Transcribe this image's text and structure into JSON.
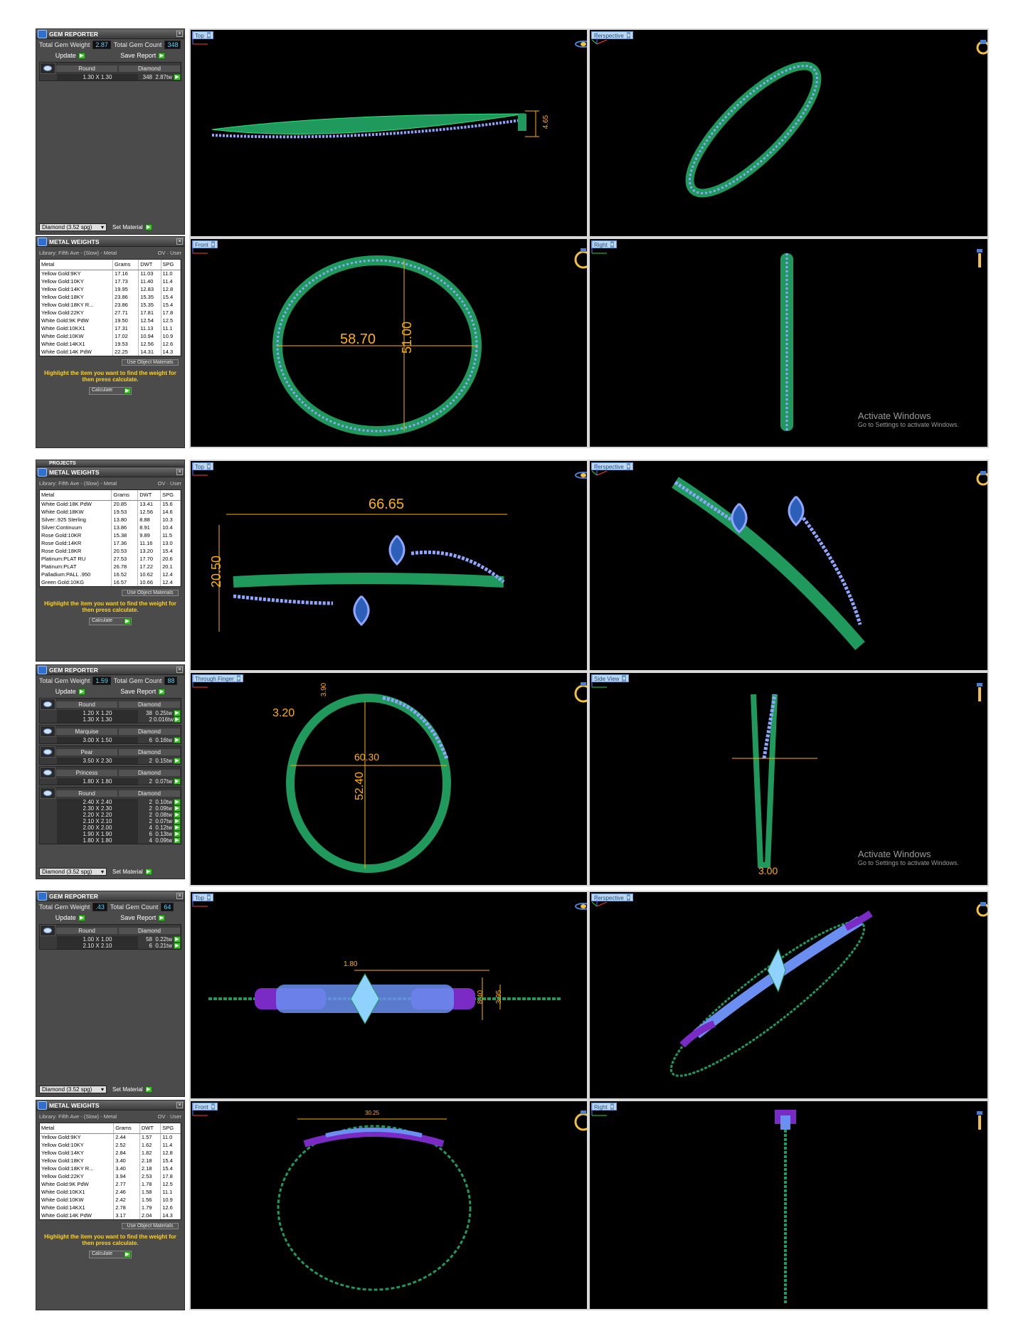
{
  "block1": {
    "gem": {
      "title": "GEM REPORTER",
      "weight_label": "Total Gem Weight",
      "weight": "2.87",
      "count_label": "Total Gem Count",
      "count": "348",
      "update": "Update",
      "save": "Save Report",
      "gems": [
        {
          "name": "Round",
          "type": "Diamond",
          "rows": [
            {
              "size": "1.30 X 1.30",
              "count": "348",
              "weight": "2.87tw"
            }
          ]
        }
      ],
      "material": "Diamond",
      "material_spg": "(3.52 spg)",
      "set_material": "Set Material"
    },
    "metal": {
      "title": "METAL WEIGHTS",
      "library": "Library: Fifth Ave - (Slow) - Metal",
      "ov": "OV",
      "user": "User",
      "headers": [
        "Metal",
        "Grams",
        "DWT",
        "SPG"
      ],
      "rows": [
        [
          "Yellow Gold:9KY",
          "17.16",
          "11.03",
          "11.0"
        ],
        [
          "Yellow Gold:10KY",
          "17.73",
          "11.40",
          "11.4"
        ],
        [
          "Yellow Gold:14KY",
          "19.95",
          "12.83",
          "12.8"
        ],
        [
          "Yellow Gold:18KY",
          "23.86",
          "15.35",
          "15.4"
        ],
        [
          "Yellow Gold:18KY R...",
          "23.86",
          "15.35",
          "15.4"
        ],
        [
          "Yellow Gold:22KY",
          "27.71",
          "17.81",
          "17.8"
        ],
        [
          "White Gold:9K PdW",
          "19.50",
          "12.54",
          "12.5"
        ],
        [
          "White Gold:10KX1",
          "17.31",
          "11.13",
          "11.1"
        ],
        [
          "White Gold:10KW",
          "17.02",
          "10.94",
          "10.9"
        ],
        [
          "White Gold:14KX1",
          "19.53",
          "12.56",
          "12.6"
        ],
        [
          "White Gold:14K PdW",
          "22.25",
          "14.31",
          "14.3"
        ]
      ],
      "useobj": "Use Object Materials",
      "hint": "Highlight the item you want to find the weight for then press calculate.",
      "calc": "Calculate"
    },
    "views": {
      "top": "Top",
      "persp": "Perspective",
      "front": "Front",
      "right": "Right",
      "dim1": "4.65",
      "dim_w": "58.70",
      "dim_h": "51.00"
    },
    "wm": {
      "line1": "Activate Windows",
      "line2": "Go to Settings to activate Windows."
    }
  },
  "block2": {
    "projects": "PROJECTS",
    "metal": {
      "title": "METAL WEIGHTS",
      "library": "Library: Fifth Ave - (Slow) - Metal",
      "ov": "OV",
      "user": "User",
      "headers": [
        "Metal",
        "Grams",
        "DWT",
        "SPG"
      ],
      "rows": [
        [
          "White Gold:18K PdW",
          "20.85",
          "13.41",
          "15.6"
        ],
        [
          "White Gold:18KW",
          "19.53",
          "12.56",
          "14.6"
        ],
        [
          "Silver:.925 Sterling",
          "13.80",
          "8.88",
          "10.3"
        ],
        [
          "Silver:Continuum",
          "13.86",
          "8.91",
          "10.4"
        ],
        [
          "Rose Gold:10KR",
          "15.38",
          "9.89",
          "11.5"
        ],
        [
          "Rose Gold:14KR",
          "17.36",
          "11.16",
          "13.0"
        ],
        [
          "Rose Gold:18KR",
          "20.53",
          "13.20",
          "15.4"
        ],
        [
          "Platinum:PLAT RU",
          "27.53",
          "17.70",
          "20.6"
        ],
        [
          "Platinum:PLAT",
          "26.78",
          "17.22",
          "20.1"
        ],
        [
          "Palladium:PALL .950",
          "16.52",
          "10.62",
          "12.4"
        ],
        [
          "Green Gold:10KG",
          "16.57",
          "10.66",
          "12.4"
        ]
      ],
      "useobj": "Use Object Materials",
      "hint": "Highlight the item you want to find the weight for then press calculate.",
      "calc": "Calculate"
    },
    "gem": {
      "title": "GEM REPORTER",
      "weight_label": "Total Gem Weight",
      "weight": "1.59",
      "count_label": "Total Gem Count",
      "count": "88",
      "update": "Update",
      "save": "Save Report",
      "gems": [
        {
          "name": "Round",
          "type": "Diamond",
          "rows": [
            {
              "size": "1.20 X 1.20",
              "count": "38",
              "weight": "0.25tw"
            },
            {
              "size": "1.30 X 1.30",
              "count": "2",
              "weight": "0.016tw"
            }
          ]
        },
        {
          "name": "Marquise",
          "type": "Diamond",
          "rows": [
            {
              "size": "3.00 X 1.50",
              "count": "6",
              "weight": "0.16tw"
            }
          ]
        },
        {
          "name": "Pear",
          "type": "Diamond",
          "rows": [
            {
              "size": "3.50 X 2.30",
              "count": "2",
              "weight": "0.15tw"
            }
          ]
        },
        {
          "name": "Princess",
          "type": "Diamond",
          "rows": [
            {
              "size": "1.80 X 1.80",
              "count": "2",
              "weight": "0.07tw"
            }
          ]
        },
        {
          "name": "Round",
          "type": "Diamond",
          "rows": [
            {
              "size": "2.40 X 2.40",
              "count": "2",
              "weight": "0.10tw"
            },
            {
              "size": "2.30 X 2.30",
              "count": "2",
              "weight": "0.09tw"
            },
            {
              "size": "2.20 X 2.20",
              "count": "2",
              "weight": "0.08tw"
            },
            {
              "size": "2.10 X 2.10",
              "count": "2",
              "weight": "0.07tw"
            },
            {
              "size": "2.00 X 2.00",
              "count": "4",
              "weight": "0.12tw"
            },
            {
              "size": "1.90 X 1.90",
              "count": "6",
              "weight": "0.13tw"
            },
            {
              "size": "1.80 X 1.80",
              "count": "4",
              "weight": "0.09tw"
            }
          ]
        }
      ],
      "material": "Diamond",
      "material_spg": "(3.52 spg)",
      "set_material": "Set Material"
    },
    "views": {
      "top": "Top",
      "persp": "Perspective",
      "front": "Through Finger",
      "right": "Side View",
      "dim_w": "66.65",
      "dim_h": "20.50",
      "dim_a": "3.20",
      "dim_b": "3.90",
      "dim_c": "60.30",
      "dim_d": "52.40",
      "dim_e": "3.00"
    },
    "wm": {
      "line1": "Activate Windows",
      "line2": "Go to Settings to activate Windows."
    }
  },
  "block3": {
    "gem": {
      "title": "GEM REPORTER",
      "weight_label": "Total Gem Weight",
      "weight": ".43",
      "count_label": "Total Gem Count",
      "count": "64",
      "update": "Update",
      "save": "Save Report",
      "gems": [
        {
          "name": "Round",
          "type": "Diamond",
          "rows": [
            {
              "size": "1.00 X 1.00",
              "count": "58",
              "weight": "0.22tw"
            },
            {
              "size": "2.10 X 2.10",
              "count": "6",
              "weight": "0.21tw"
            }
          ]
        }
      ],
      "material": "Diamond",
      "material_spg": "(3.52 spg)",
      "set_material": "Set Material"
    },
    "metal": {
      "title": "METAL WEIGHTS",
      "library": "Library: Fifth Ave - (Slow) - Metal",
      "ov": "OV",
      "user": "User",
      "headers": [
        "Metal",
        "Grams",
        "DWT",
        "SPG"
      ],
      "rows": [
        [
          "Yellow Gold:9KY",
          "2.44",
          "1.57",
          "11.0"
        ],
        [
          "Yellow Gold:10KY",
          "2.52",
          "1.62",
          "11.4"
        ],
        [
          "Yellow Gold:14KY",
          "2.84",
          "1.82",
          "12.8"
        ],
        [
          "Yellow Gold:18KY",
          "3.40",
          "2.18",
          "15.4"
        ],
        [
          "Yellow Gold:18KY R...",
          "3.40",
          "2.18",
          "15.4"
        ],
        [
          "Yellow Gold:22KY",
          "3.94",
          "2.53",
          "17.8"
        ],
        [
          "White Gold:9K PdW",
          "2.77",
          "1.78",
          "12.5"
        ],
        [
          "White Gold:10KX1",
          "2.46",
          "1.58",
          "11.1"
        ],
        [
          "White Gold:10KW",
          "2.42",
          "1.56",
          "10.9"
        ],
        [
          "White Gold:14KX1",
          "2.78",
          "1.79",
          "12.6"
        ],
        [
          "White Gold:14K PdW",
          "3.17",
          "2.04",
          "14.3"
        ]
      ],
      "useobj": "Use Object Materials",
      "hint": "Highlight the item you want to find the weight for then press calculate.",
      "calc": "Calculate"
    },
    "views": {
      "top": "Top",
      "persp": "Perspective",
      "front": "Front",
      "right": "Right",
      "dim_a": "1.80",
      "dim_b": "8.40",
      "dim_c": "3.95",
      "dim_d": "30.25"
    }
  }
}
